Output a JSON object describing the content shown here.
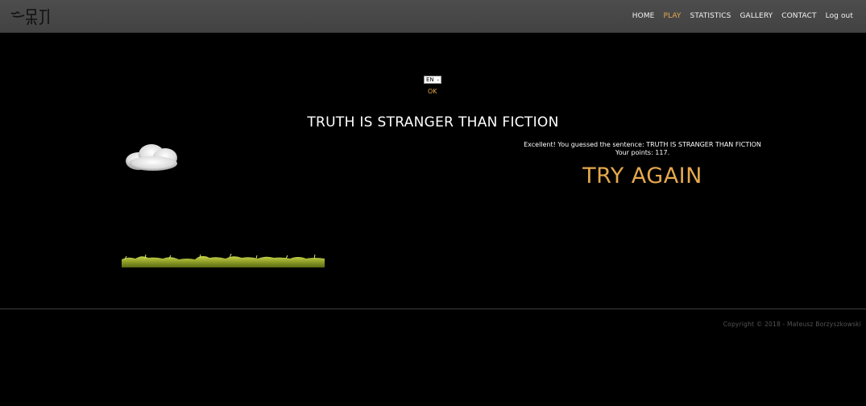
{
  "nav": {
    "items": [
      {
        "label": "HOME",
        "active": false
      },
      {
        "label": "PLAY",
        "active": true
      },
      {
        "label": "STATISTICS",
        "active": false
      },
      {
        "label": "GALLERY",
        "active": false
      },
      {
        "label": "CONTACT",
        "active": false
      },
      {
        "label": "Log out",
        "active": false
      }
    ],
    "active_color": "#e5a84d",
    "logo_icon": "handwritten-logo-icon"
  },
  "language": {
    "selected": "EN",
    "ok_label": "OK"
  },
  "game": {
    "sentence": "TRUTH IS STRANGER THAN FICTION",
    "message_line1": "Excellent! You guessed the sentence: TRUTH IS STRANGER THAN FICTION",
    "message_line2": "Your points: 117.",
    "try_again_label": "TRY AGAIN",
    "scene_icons": [
      "cloud-icon",
      "grass-ground-icon"
    ]
  },
  "footer": {
    "copyright": "Copyright © 2018 - Mateusz Borzyszkowski"
  }
}
